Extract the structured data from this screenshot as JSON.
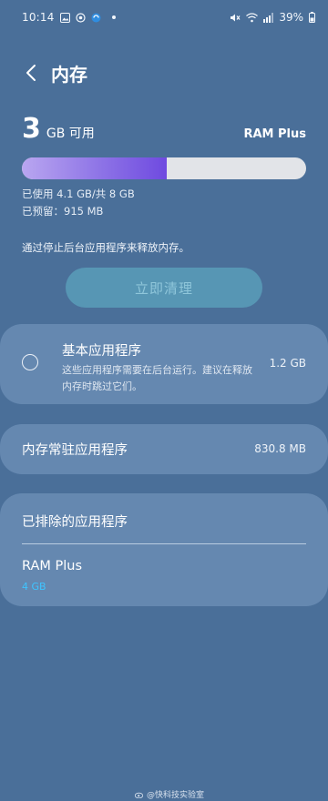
{
  "status_bar": {
    "time": "10:14",
    "battery": "39%",
    "icons": [
      "gallery-icon",
      "settings-icon",
      "browser-icon",
      "mute-icon",
      "wifi-icon",
      "signal-icon",
      "battery-icon"
    ]
  },
  "header": {
    "title": "内存"
  },
  "memory": {
    "available_number": "3",
    "available_unit": "GB 可用",
    "ram_plus_link": "RAM Plus",
    "used_fraction": 0.51,
    "used_text": "已使用 4.1 GB/共 8 GB",
    "reserved_text": "已预留：915 MB",
    "bar_fill_color": "#6f4ae0",
    "bar_track_color": "#e2e4e8"
  },
  "hint": "通过停止后台应用程序来释放内存。",
  "clean_button": "立即清理",
  "basic_apps": {
    "title": "基本应用程序",
    "description": "这些应用程序需要在后台运行。建议在释放内存时跳过它们。",
    "size": "1.2 GB"
  },
  "resident_apps": {
    "label": "内存常驻应用程序",
    "size": "830.8 MB"
  },
  "excluded_apps": {
    "header": "已排除的应用程序",
    "ram_plus_title": "RAM Plus",
    "ram_plus_value": "4 GB"
  },
  "watermark": "@快科技实验室",
  "colors": {
    "background": "#4a6f99",
    "card": "#6588b0",
    "accent_blue": "#3fc4ff",
    "button": "#5796b4"
  }
}
